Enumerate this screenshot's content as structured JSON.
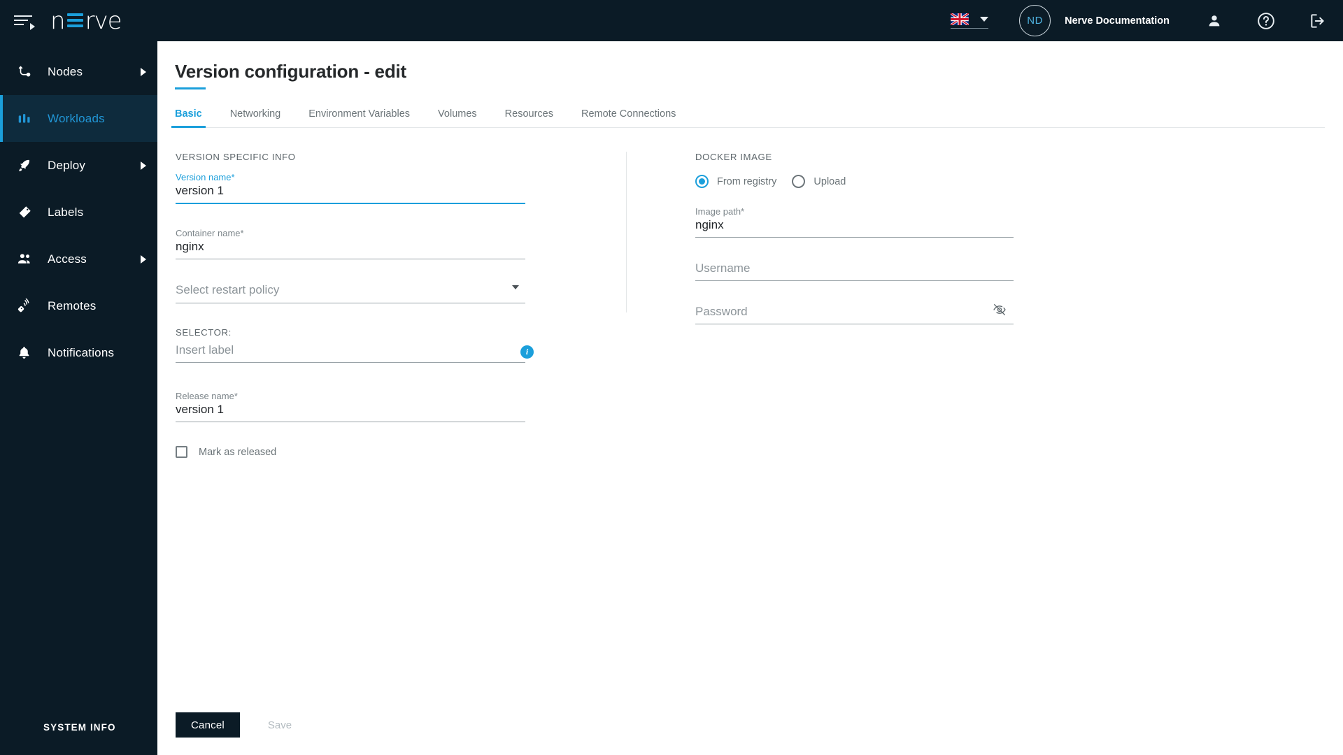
{
  "topbar": {
    "menu_icon": "hamburger-icon",
    "logo_text": "nerve",
    "logo_prefix": "n",
    "logo_suffix": "rve",
    "language_flag": "uk-flag-icon",
    "language_caret": "chevron-down-icon",
    "avatar_initials": "ND",
    "user_name": "Nerve Documentation",
    "person_icon": "person-icon",
    "help_icon": "help-icon",
    "logout_icon": "logout-icon"
  },
  "sidebar": {
    "items": [
      {
        "label": "Nodes",
        "icon": "nodes-icon",
        "active": false,
        "has_arrow": true
      },
      {
        "label": "Workloads",
        "icon": "workloads-icon",
        "active": true,
        "has_arrow": false
      },
      {
        "label": "Deploy",
        "icon": "deploy-rocket-icon",
        "active": false,
        "has_arrow": true
      },
      {
        "label": "Labels",
        "icon": "labels-tag-icon",
        "active": false,
        "has_arrow": false
      },
      {
        "label": "Access",
        "icon": "access-users-icon",
        "active": false,
        "has_arrow": true
      },
      {
        "label": "Remotes",
        "icon": "remotes-icon",
        "active": false,
        "has_arrow": false
      },
      {
        "label": "Notifications",
        "icon": "bell-icon",
        "active": false,
        "has_arrow": false
      }
    ],
    "system_info": "SYSTEM INFO"
  },
  "page": {
    "title": "Version configuration - edit",
    "tabs": [
      {
        "label": "Basic",
        "active": true
      },
      {
        "label": "Networking",
        "active": false
      },
      {
        "label": "Environment Variables",
        "active": false
      },
      {
        "label": "Volumes",
        "active": false
      },
      {
        "label": "Resources",
        "active": false
      },
      {
        "label": "Remote Connections",
        "active": false
      }
    ]
  },
  "version_specific": {
    "section_title": "VERSION SPECIFIC INFO",
    "version_name_label": "Version name*",
    "version_name_value": "version 1",
    "container_name_label": "Container name*",
    "container_name_value": "nginx",
    "restart_policy_placeholder": "Select restart policy",
    "selector_title": "SELECTOR:",
    "selector_placeholder": "Insert label",
    "selector_info_icon": "info-icon",
    "release_name_label": "Release name*",
    "release_name_value": "version 1",
    "mark_released_label": "Mark as released",
    "mark_released_checked": false
  },
  "docker_image": {
    "section_title": "DOCKER IMAGE",
    "source_options": [
      {
        "label": "From registry",
        "selected": true
      },
      {
        "label": "Upload",
        "selected": false
      }
    ],
    "image_path_label": "Image path*",
    "image_path_value": "nginx",
    "username_placeholder": "Username",
    "username_value": "",
    "password_placeholder": "Password",
    "password_value": "",
    "password_toggle_icon": "eye-off-icon"
  },
  "footer": {
    "cancel_label": "Cancel",
    "save_label": "Save"
  },
  "colors": {
    "accent": "#1b9fdb",
    "dark": "#0b1b26",
    "active_nav_bg": "#0e2b3d"
  }
}
